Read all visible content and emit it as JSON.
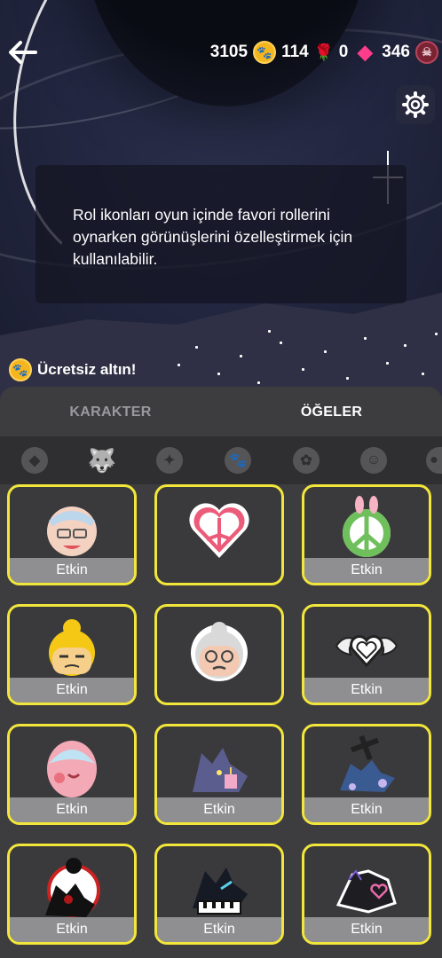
{
  "header": {
    "back_icon": "arrow-left-icon",
    "currencies": [
      {
        "icon": "paw-coin-icon",
        "value": "3105"
      },
      {
        "icon": "rose-icon",
        "value": "114"
      },
      {
        "icon": "gem-icon",
        "value": "0"
      },
      {
        "icon": "skull-coin-icon",
        "value": "346"
      }
    ],
    "settings_icon": "gear-icon"
  },
  "info": {
    "text": "Rol ikonları oyun içinde favori rollerini oynarken görünüşlerini özelleştirmek için kullanılabilir."
  },
  "free_gold": {
    "label": "Ücretsiz altın!",
    "icon": "paw-coin-icon"
  },
  "tabs": [
    {
      "label": "KARAKTER",
      "active": false
    },
    {
      "label": "ÖĞELER",
      "active": true
    }
  ],
  "categories": [
    {
      "icon": "wolf-badge-icon",
      "active": false
    },
    {
      "icon": "wolf-head-icon",
      "active": true
    },
    {
      "icon": "gift-icon",
      "active": false
    },
    {
      "icon": "paw-icon",
      "active": false
    },
    {
      "icon": "paw-frame-icon",
      "active": false
    },
    {
      "icon": "smiley-icon",
      "active": false
    },
    {
      "icon": "person-icon",
      "active": false
    }
  ],
  "items": [
    {
      "name": "sleepy-grandma-icon",
      "label": "Etkin"
    },
    {
      "name": "peace-heart-icon",
      "label": ""
    },
    {
      "name": "peace-wreath-icon",
      "label": "Etkin"
    },
    {
      "name": "yellow-hair-face-icon",
      "label": "Etkin"
    },
    {
      "name": "grandma-face-icon",
      "label": ""
    },
    {
      "name": "winged-heart-icon",
      "label": "Etkin"
    },
    {
      "name": "easter-egg-face-icon",
      "label": "Etkin"
    },
    {
      "name": "wolf-cake-icon",
      "label": "Etkin"
    },
    {
      "name": "wolf-cross-icon",
      "label": "Etkin"
    },
    {
      "name": "wolf-rose-icon",
      "label": "Etkin"
    },
    {
      "name": "wolf-piano-icon",
      "label": "Etkin"
    },
    {
      "name": "wolf-rainbow-heart-icon",
      "label": "Etkin"
    }
  ],
  "colors": {
    "accent_border": "#f2e63b",
    "panel": "#3d3d3f",
    "label_bg": "#8f8f91"
  }
}
